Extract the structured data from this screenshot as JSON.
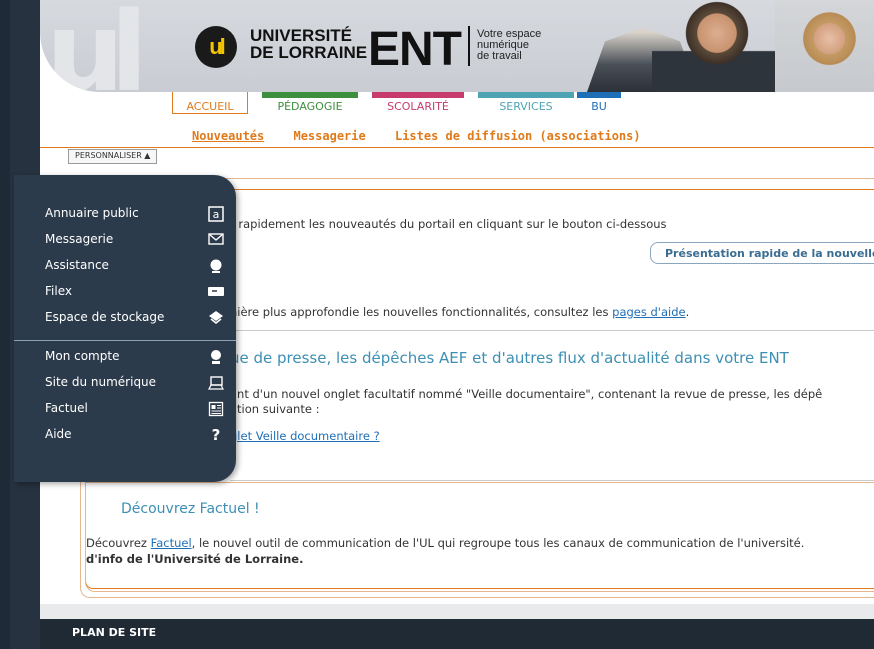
{
  "header": {
    "logo_initials": "ul",
    "logo_line1": "UNIVERSITÉ",
    "logo_line2": "DE LORRAINE",
    "ent": "ENT",
    "tagline1": "Votre espace",
    "tagline2": "numérique",
    "tagline3": "de travail"
  },
  "nav": {
    "tabs": [
      {
        "label": "ACCUEIL",
        "color": "#e07a1a"
      },
      {
        "label": "PÉDAGOGIE",
        "color": "#3d8f3d"
      },
      {
        "label": "SCOLARITÉ",
        "color": "#c73a6e"
      },
      {
        "label": "SERVICES",
        "color": "#4fa4b3"
      },
      {
        "label": "BU",
        "color": "#1f6fb8"
      }
    ]
  },
  "subnav": {
    "items": [
      "Nouveautés",
      "Messagerie",
      "Listes de diffusion (associations)"
    ]
  },
  "personalize": "PERSONNALISER ▲",
  "content": {
    "line1": "r rapidement les nouveautés du portail en cliquant sur le bouton ci-dessous",
    "button": "Présentation rapide de la nouvelle",
    "line2_pre": "nière plus approfondie les nouvelles fonctionnalités, consultez les ",
    "line2_link": "pages d'aide",
    "line2_post": ".",
    "heading2": "ue de presse, les dépêches AEF et d'autres flux d'actualité dans votre ENT",
    "line3": "ant d'un nouvel onglet facultatif nommé \"Veille documentaire\", contenant la revue de presse, les dépê",
    "line4": "ation suivante :",
    "line5_link": "glet Veille documentaire ?",
    "factuel_heading": "Découvrez Factuel !",
    "factuel_pre": "Découvrez ",
    "factuel_link": "Factuel",
    "factuel_post": ", le nouvel outil de communication de l'UL qui regroupe tous les canaux de communication de l'université.",
    "factuel_bold": "d'info de l'Université de Lorraine."
  },
  "menu": {
    "items": [
      {
        "label": "Annuaire public",
        "icon": "directory-icon"
      },
      {
        "label": "Messagerie",
        "icon": "envelope-icon"
      },
      {
        "label": "Assistance",
        "icon": "support-icon"
      },
      {
        "label": "Filex",
        "icon": "file-transfer-icon"
      },
      {
        "label": "Espace de stockage",
        "icon": "storage-icon"
      },
      {
        "label": "Mon compte",
        "icon": "account-icon"
      },
      {
        "label": "Site du numérique",
        "icon": "website-icon"
      },
      {
        "label": "Factuel",
        "icon": "news-icon"
      },
      {
        "label": "Aide",
        "icon": "help-icon"
      }
    ]
  },
  "footer": {
    "label": "PLAN DE SITE"
  }
}
